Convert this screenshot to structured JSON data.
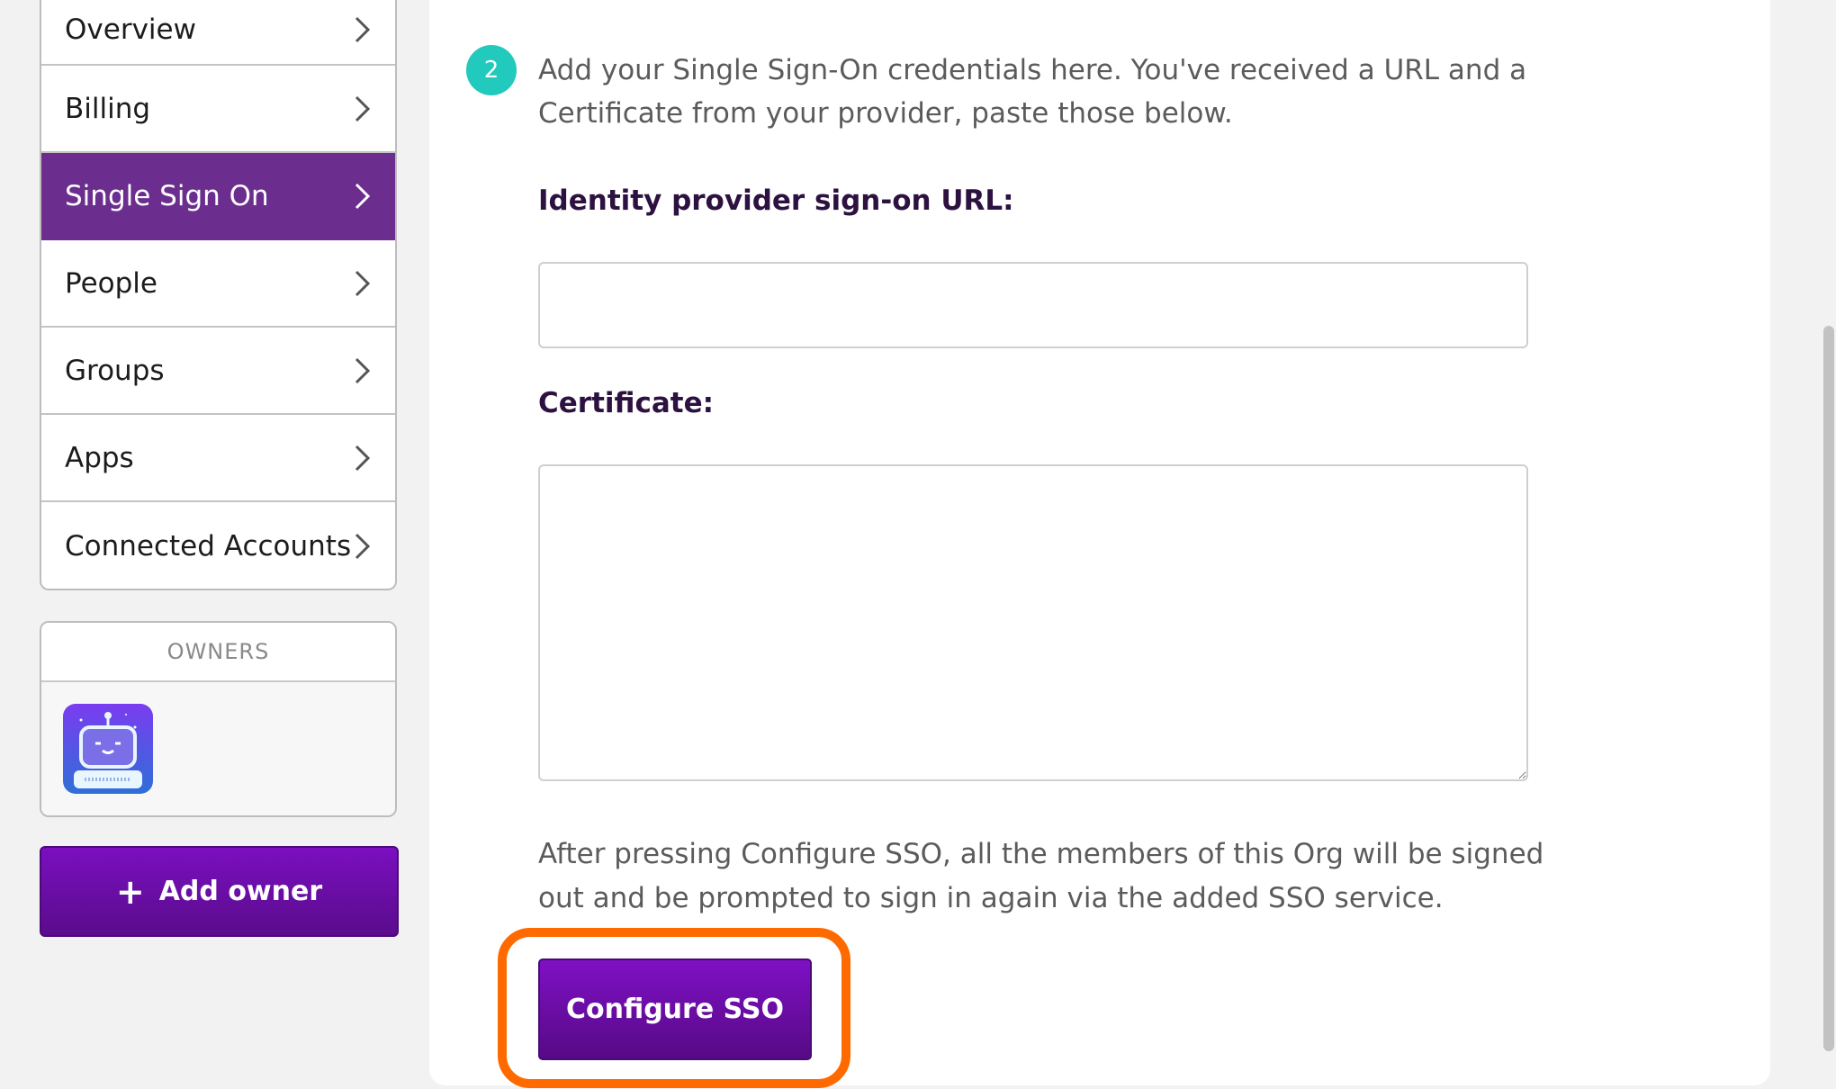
{
  "sidebar": {
    "items": [
      {
        "label": "Overview"
      },
      {
        "label": "Billing"
      },
      {
        "label": "Single Sign On"
      },
      {
        "label": "People"
      },
      {
        "label": "Groups"
      },
      {
        "label": "Apps"
      },
      {
        "label": "Connected Accounts"
      }
    ],
    "active_item": "Single Sign On"
  },
  "owners": {
    "header": "OWNERS",
    "avatar_icon": "robot-avatar-icon",
    "add_owner_label": "Add owner",
    "add_owner_icon": "plus-icon"
  },
  "main": {
    "step_number": "2",
    "step_text": "Add your Single Sign-On credentials here. You've received a URL and a Certificate from your provider, paste those below.",
    "url_label": "Identity provider sign-on URL:",
    "url_value": "",
    "certificate_label": "Certificate:",
    "certificate_value": "",
    "note": "After pressing Configure SSO, all the members of this Org will be signed out and be prompted to sign in again via the added SSO service.",
    "configure_button": "Configure SSO"
  },
  "colors": {
    "accent_purple": "#6b2e8f",
    "button_purple": "#6f0eb0",
    "step_teal": "#22c9bd",
    "highlight_orange": "#ff6a00"
  }
}
